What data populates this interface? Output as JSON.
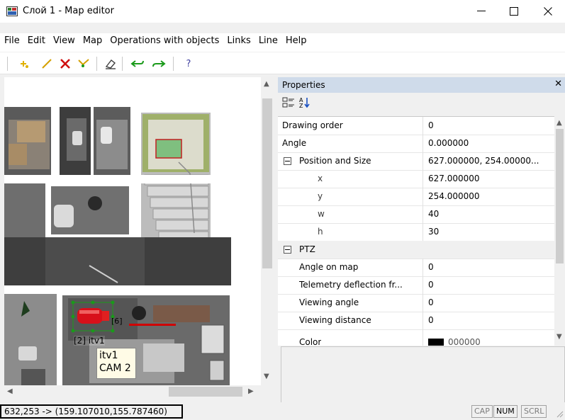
{
  "window": {
    "title": "Слой 1 - Map editor",
    "minimize": "—",
    "maximize": "☐",
    "close": "✕"
  },
  "menu": [
    "File",
    "Edit",
    "View",
    "Map",
    "Operations with objects",
    "Links",
    "Line",
    "Help"
  ],
  "toolbar": {
    "help_label": "?",
    "icons": [
      "add-object-icon",
      "draw-line-icon",
      "delete-icon",
      "select-points-icon",
      "eraser-icon",
      "undo-icon",
      "redo-icon",
      "help-icon"
    ]
  },
  "map": {
    "camera_label": "[2] itv1",
    "tooltip_line1": "itv1",
    "tooltip_line2": "CAM 2",
    "object_number": "[6]"
  },
  "properties": {
    "title": "Properties",
    "close": "✕",
    "rows": [
      {
        "name": "Drawing order",
        "value": "0"
      },
      {
        "name": "Angle",
        "value": "0.000000"
      },
      {
        "name": "Position and Size",
        "value": "627.000000, 254.00000..."
      },
      {
        "name": "x",
        "value": "627.000000"
      },
      {
        "name": "y",
        "value": "254.000000"
      },
      {
        "name": "w",
        "value": "40"
      },
      {
        "name": "h",
        "value": "30"
      },
      {
        "name": "PTZ",
        "value": ""
      },
      {
        "name": "Angle on map",
        "value": "0"
      },
      {
        "name": "Telemetry deflection fr...",
        "value": "0"
      },
      {
        "name": "Viewing angle",
        "value": "0"
      },
      {
        "name": "Viewing distance",
        "value": "0"
      },
      {
        "name": "Color",
        "value": "000000"
      }
    ]
  },
  "status": {
    "coordinates": "632,253 -> (159.107010,155.787460)",
    "cap": "CAP",
    "num": "NUM",
    "scrl": "SCRL"
  },
  "colors": {
    "properties_header": "#cfdbea",
    "camera_red": "#d8101a",
    "selection_green": "#1a9a1a"
  }
}
